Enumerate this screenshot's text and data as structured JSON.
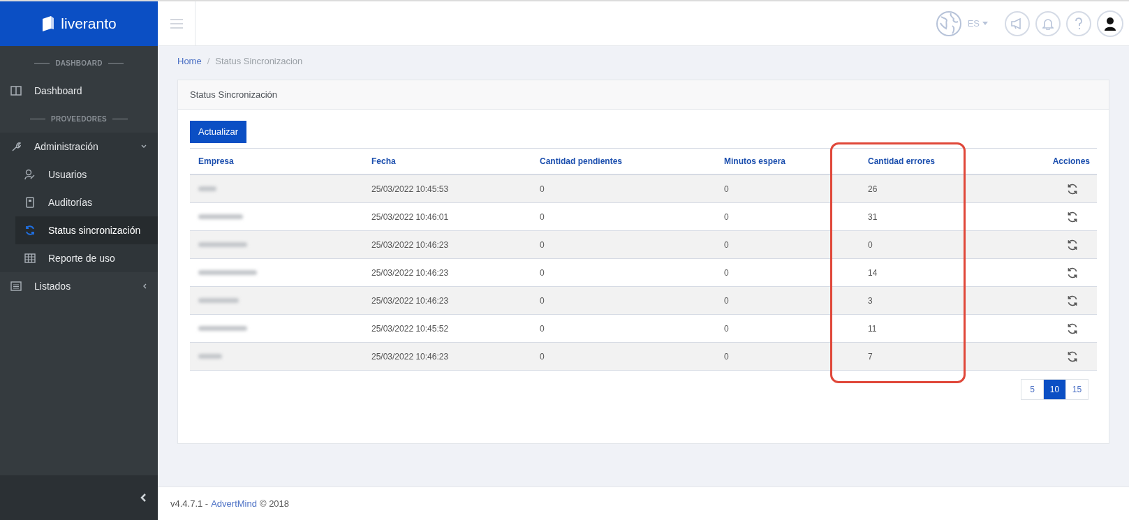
{
  "brand": {
    "name": "liveranto"
  },
  "topbar": {
    "language": "ES"
  },
  "sidebar": {
    "items": [
      {
        "kind": "section",
        "label": "DASHBOARD"
      },
      {
        "kind": "item",
        "label": "Dashboard",
        "selected": false
      },
      {
        "kind": "section",
        "label": "PROVEEDORES"
      },
      {
        "kind": "item",
        "label": "Administración",
        "selected": false,
        "expanded": true,
        "children": [
          {
            "label": "Usuarios",
            "selected": false
          },
          {
            "label": "Auditorías",
            "selected": false
          },
          {
            "label": "Status sincronización",
            "selected": true
          },
          {
            "label": "Reporte de uso",
            "selected": false
          }
        ]
      },
      {
        "kind": "item",
        "label": "Listados",
        "selected": false,
        "expanded": false
      }
    ]
  },
  "breadcrumb": {
    "separator": "/",
    "items": [
      {
        "label": "Home"
      },
      {
        "label": "Status Sincronizacion"
      }
    ]
  },
  "card": {
    "title": "Status Sincronización",
    "button": "Actualizar"
  },
  "table": {
    "columns": [
      {
        "label": "Empresa"
      },
      {
        "label": "Fecha"
      },
      {
        "label": "Cantidad pendientes"
      },
      {
        "label": "Minutos espera"
      },
      {
        "label": "Cantidad errores"
      },
      {
        "label": "Acciones"
      }
    ],
    "errors_column_circled": true,
    "rows": [
      {
        "fecha": "25/03/2022 10:45:53",
        "pendientes": "0",
        "minutos": "0",
        "errores": "26"
      },
      {
        "fecha": "25/03/2022 10:46:01",
        "pendientes": "0",
        "minutos": "0",
        "errores": "31"
      },
      {
        "fecha": "25/03/2022 10:46:23",
        "pendientes": "0",
        "minutos": "0",
        "errores": "0"
      },
      {
        "fecha": "25/03/2022 10:46:23",
        "pendientes": "0",
        "minutos": "0",
        "errores": "14"
      },
      {
        "fecha": "25/03/2022 10:46:23",
        "pendientes": "0",
        "minutos": "0",
        "errores": "3"
      },
      {
        "fecha": "25/03/2022 10:45:52",
        "pendientes": "0",
        "minutos": "0",
        "errores": "11"
      },
      {
        "fecha": "25/03/2022 10:46:23",
        "pendientes": "0",
        "minutos": "0",
        "errores": "7"
      }
    ]
  },
  "pagination": [
    {
      "label": "5",
      "selected": false
    },
    {
      "label": "10",
      "selected": true
    },
    {
      "label": "15",
      "selected": false
    }
  ],
  "footer": {
    "version": "v4.4.7.1 -",
    "link": "AdvertMind",
    "copyright": "© 2018"
  }
}
